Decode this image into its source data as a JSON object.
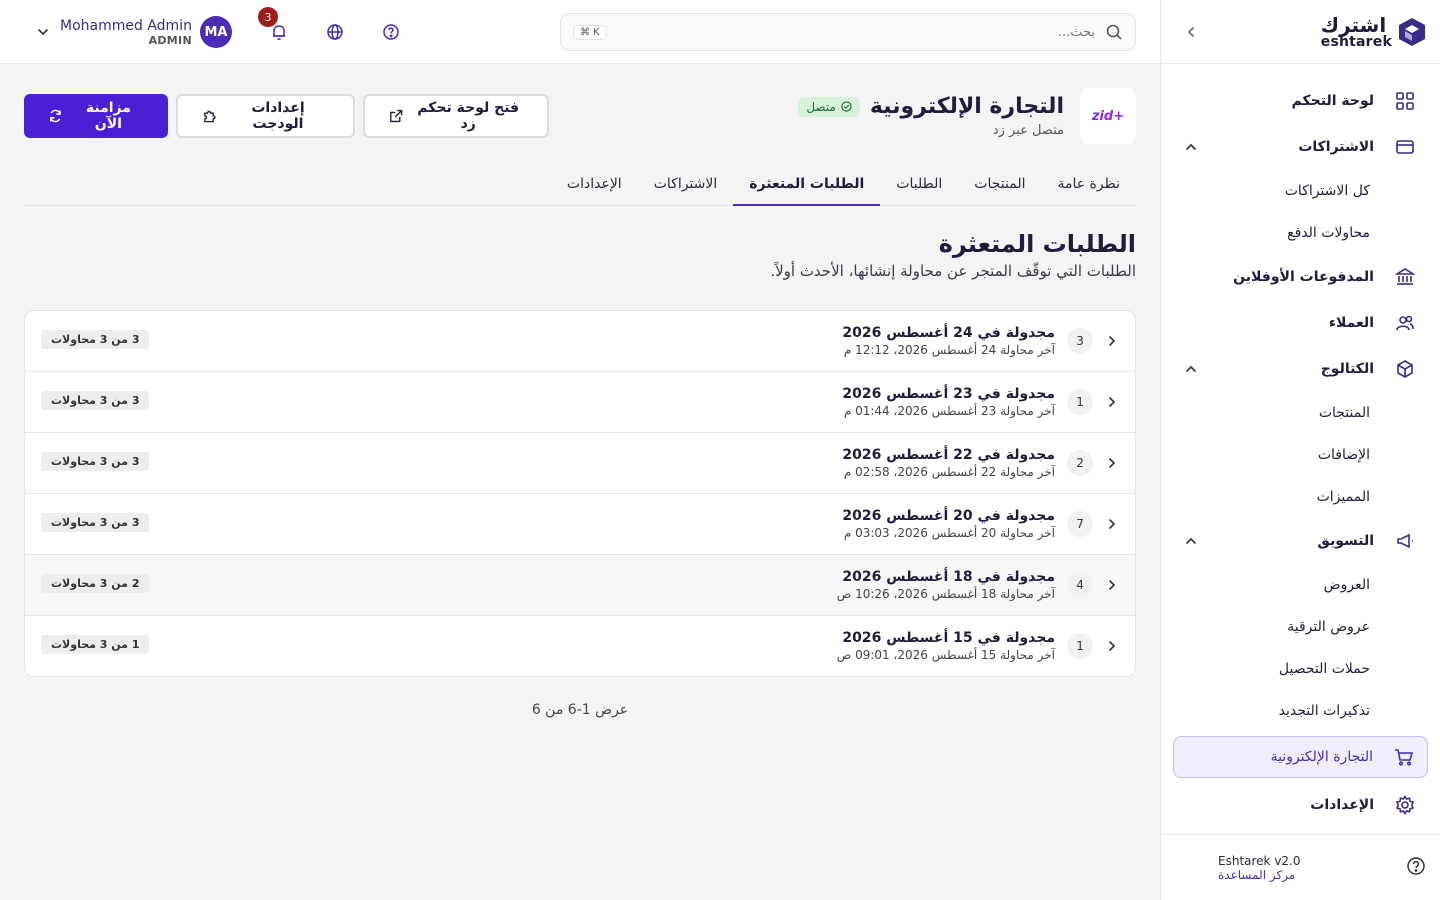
{
  "brand": {
    "logo_ar": "اشترك",
    "logo_en": "eshtarek"
  },
  "sidebar": {
    "items": [
      {
        "label": "لوحة التحكم",
        "icon": "grid-icon"
      },
      {
        "label": "الاشتراكات",
        "icon": "card-icon",
        "sub": [
          "كل الاشتراكات",
          "محاولات الدفع"
        ]
      },
      {
        "label": "المدفوعات الأوفلاين",
        "icon": "bank-icon"
      },
      {
        "label": "العملاء",
        "icon": "users-icon"
      },
      {
        "label": "الكتالوج",
        "icon": "box-icon",
        "sub": [
          "المنتجات",
          "الإضافات",
          "المميزات"
        ]
      },
      {
        "label": "التسويق",
        "icon": "megaphone-icon",
        "sub": [
          "العروض",
          "عروض الترقية",
          "حملات التحصيل",
          "تذكيرات التجديد"
        ]
      },
      {
        "label": "التجارة الإلكترونية",
        "icon": "cart-icon",
        "active": true
      },
      {
        "label": "الإعدادات",
        "icon": "gear-icon"
      }
    ],
    "footer": {
      "version": "Eshtarek v2.0",
      "help": "مركز المساعدة"
    }
  },
  "topbar": {
    "search_placeholder": "بحث...",
    "shortcut": "⌘ K",
    "notifications_count": "3",
    "user": {
      "name": "Mohammed Admin",
      "role": "ADMIN",
      "initials": "MA"
    }
  },
  "store": {
    "logo_text": "zid",
    "title": "التجارة الإلكترونية",
    "status": "متصل",
    "subtitle": "متصل عبر زد"
  },
  "actions": {
    "sync": "مزامنة الآن",
    "widget": "إعدادات الودجت",
    "open_zid": "فتح لوحة تحكم زد"
  },
  "tabs": [
    "نظرة عامة",
    "المنتجات",
    "الطلبات",
    "الطلبات المتعثرة",
    "الاشتراكات",
    "الإعدادات"
  ],
  "active_tab": "الطلبات المتعثرة",
  "section": {
    "title": "الطلبات المتعثرة",
    "subtitle": "الطلبات التي توقّف المتجر عن محاولة إنشائها، الأحدث أولاً."
  },
  "rows": [
    {
      "count": "3",
      "title": "مجدولة في 24 أغسطس 2026",
      "sub": "آخر محاولة 24 أغسطس 2026، 12:12 م",
      "attempts": "3 من 3 محاولات"
    },
    {
      "count": "1",
      "title": "مجدولة في 23 أغسطس 2026",
      "sub": "آخر محاولة 23 أغسطس 2026، 01:44 م",
      "attempts": "3 من 3 محاولات"
    },
    {
      "count": "2",
      "title": "مجدولة في 22 أغسطس 2026",
      "sub": "آخر محاولة 22 أغسطس 2026، 02:58 م",
      "attempts": "3 من 3 محاولات"
    },
    {
      "count": "7",
      "title": "مجدولة في 20 أغسطس 2026",
      "sub": "آخر محاولة 20 أغسطس 2026، 03:03 م",
      "attempts": "3 من 3 محاولات"
    },
    {
      "count": "4",
      "title": "مجدولة في 18 أغسطس 2026",
      "sub": "آخر محاولة 18 أغسطس 2026، 10:26 ص",
      "attempts": "2 من 3 محاولات"
    },
    {
      "count": "1",
      "title": "مجدولة في 15 أغسطس 2026",
      "sub": "آخر محاولة 15 أغسطس 2026، 09:01 ص",
      "attempts": "1 من 3 محاولات"
    }
  ],
  "pagination": "عرض 1-6 من 6",
  "colors": {
    "primary": "#4b1fd6",
    "accent": "#4b2bb8",
    "success_bg": "#d8f3dc",
    "badge": "#a01b1b"
  }
}
